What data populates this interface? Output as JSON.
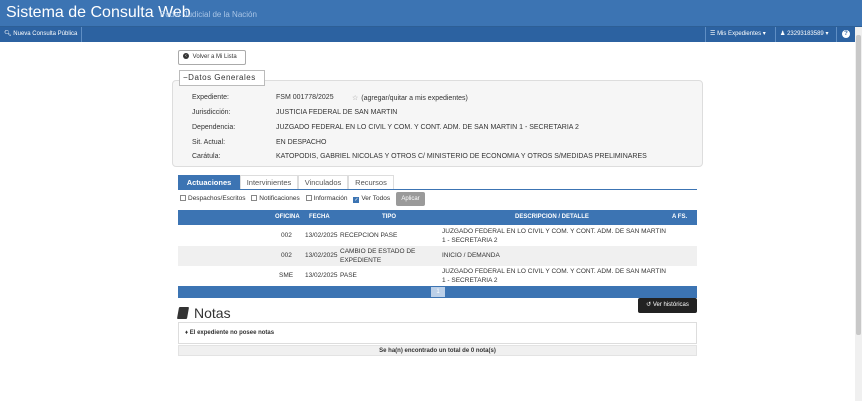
{
  "header": {
    "title": "Sistema de Consulta Web",
    "subtitle": "Poder Judicial de la Nación"
  },
  "nav": {
    "nueva_consulta": "Nueva Consulta Pública",
    "mis_expedientes": "Mis Expedientes",
    "user": "23293183589",
    "help": "?"
  },
  "back_button": "Volver a Mi Lista",
  "datos": {
    "legend": "Datos Generales",
    "fields": [
      {
        "label": "Expediente:",
        "value": "FSM 001778/2025"
      },
      {
        "label": "Jurisdicción:",
        "value": "JUSTICIA FEDERAL DE SAN MARTIN"
      },
      {
        "label": "Dependencia:",
        "value": "JUZGADO FEDERAL EN LO CIVIL Y COM. Y CONT. ADM. DE SAN MARTIN 1 - SECRETARIA 2"
      },
      {
        "label": "Sit. Actual:",
        "value": "EN DESPACHO"
      },
      {
        "label": "Carátula:",
        "value": "KATOPODIS, GABRIEL NICOLAS Y OTROS C/ MINISTERIO DE ECONOMIA Y OTROS S/MEDIDAS PRELIMINARES"
      }
    ],
    "favorite_link": "(agregar/quitar a mis expedientes)"
  },
  "tabs": [
    "Actuaciones",
    "Intervinientes",
    "Vinculados",
    "Recursos"
  ],
  "filters": {
    "despachos": "Despachos/Escritos",
    "notificaciones": "Notificaciones",
    "informacion": "Información",
    "ver_todos": "Ver Todos",
    "aplicar": "Aplicar"
  },
  "table": {
    "headers": [
      "OFICINA",
      "FECHA",
      "TIPO",
      "DESCRIPCION / DETALLE",
      "A FS."
    ],
    "rows": [
      {
        "oficina": "002",
        "fecha": "13/02/2025",
        "tipo": "RECEPCION PASE",
        "descripcion": "JUZGADO FEDERAL EN LO CIVIL Y COM. Y CONT. ADM. DE SAN MARTIN 1 - SECRETARIA 2",
        "afs": ""
      },
      {
        "oficina": "002",
        "fecha": "13/02/2025",
        "tipo": "CAMBIO DE ESTADO DE EXPEDIENTE",
        "descripcion": "INICIO / DEMANDA",
        "afs": ""
      },
      {
        "oficina": "SME",
        "fecha": "13/02/2025",
        "tipo": "PASE",
        "descripcion": "JUZGADO FEDERAL EN LO CIVIL Y COM. Y CONT. ADM. DE SAN MARTIN 1 - SECRETARIA 2",
        "afs": ""
      }
    ],
    "page": "1"
  },
  "ver_historicas": "Ver históricas",
  "notas": {
    "title": "Notas",
    "empty": "El expediente no posee notas",
    "total": "Se ha(n) encontrado un total de 0 nota(s)"
  },
  "colors": {
    "primary": "#3c74b3",
    "nav": "#2c62a1"
  }
}
